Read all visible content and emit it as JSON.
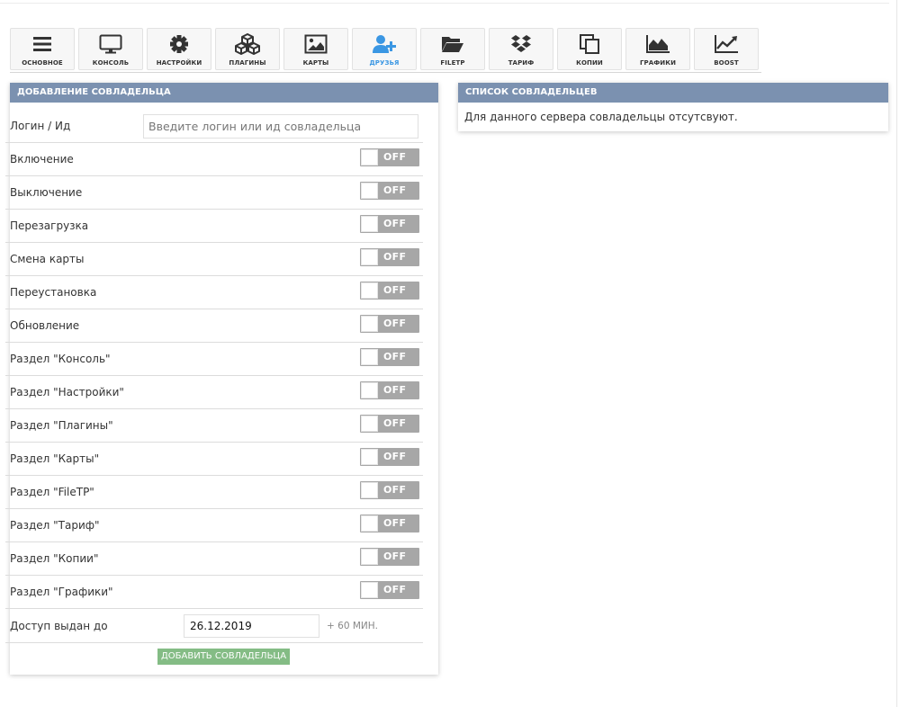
{
  "toolbar": {
    "items": [
      {
        "label": "ОСНОВНОЕ",
        "icon": "menu-icon"
      },
      {
        "label": "КОНСОЛЬ",
        "icon": "monitor-icon"
      },
      {
        "label": "НАСТРОЙКИ",
        "icon": "gear-icon"
      },
      {
        "label": "ПЛАГИНЫ",
        "icon": "cubes-icon"
      },
      {
        "label": "КАРТЫ",
        "icon": "image-icon"
      },
      {
        "label": "ДРУЗЬЯ",
        "icon": "user-plus-icon",
        "active": true
      },
      {
        "label": "FILETP",
        "icon": "folder-open-icon"
      },
      {
        "label": "ТАРИФ",
        "icon": "dropbox-icon"
      },
      {
        "label": "КОПИИ",
        "icon": "copy-icon"
      },
      {
        "label": "ГРАФИКИ",
        "icon": "area-chart-icon"
      },
      {
        "label": "BOOST",
        "icon": "line-chart-icon"
      }
    ],
    "active_color": "#3b97e3"
  },
  "add_panel": {
    "title": "ДОБАВЛЕНИЕ СОВЛАДЕЛЬЦА",
    "login_label": "Логин / Ид",
    "login_placeholder": "Введите логин или ид совладельца",
    "toggle_off_text": "OFF",
    "permissions": [
      {
        "label": "Включение",
        "state": "off"
      },
      {
        "label": "Выключение",
        "state": "off"
      },
      {
        "label": "Перезагрузка",
        "state": "off"
      },
      {
        "label": "Смена карты",
        "state": "off"
      },
      {
        "label": "Переустановка",
        "state": "off"
      },
      {
        "label": "Обновление",
        "state": "off"
      },
      {
        "label": "Раздел \"Консоль\"",
        "state": "off"
      },
      {
        "label": "Раздел \"Настройки\"",
        "state": "off"
      },
      {
        "label": "Раздел \"Плагины\"",
        "state": "off"
      },
      {
        "label": "Раздел \"Карты\"",
        "state": "off"
      },
      {
        "label": "Раздел \"FileTP\"",
        "state": "off"
      },
      {
        "label": "Раздел \"Тариф\"",
        "state": "off"
      },
      {
        "label": "Раздел \"Копии\"",
        "state": "off"
      },
      {
        "label": "Раздел \"Графики\"",
        "state": "off"
      }
    ],
    "access_label": "Доступ выдан до",
    "access_date": "26.12.2019",
    "access_hint": "+ 60 МИН.",
    "submit_label": "ДОБАВИТЬ СОВЛАДЕЛЬЦА"
  },
  "list_panel": {
    "title": "СПИСОК СОВЛАДЕЛЬЦЕВ",
    "empty_text": "Для данного сервера совладельцы отсутсвуют."
  },
  "colors": {
    "panel_header": "#7b91b0",
    "toggle_off": "#a7a7a7",
    "submit_button": "#84bc85"
  }
}
